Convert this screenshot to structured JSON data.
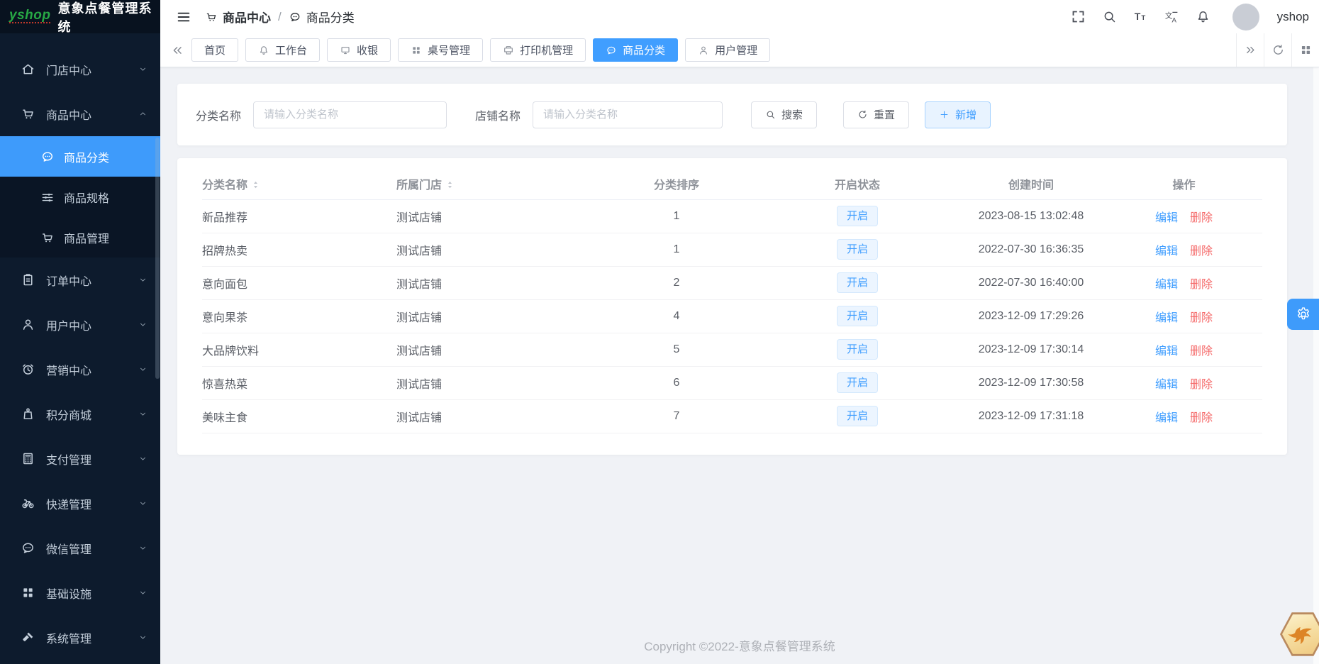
{
  "app": {
    "logo_text": "yshop",
    "title": "意象点餐管理系统"
  },
  "sidebar": {
    "items": [
      {
        "name": "store-center",
        "label": "门店中心",
        "icon": "home"
      },
      {
        "name": "goods-center",
        "label": "商品中心",
        "icon": "cart",
        "expanded": true,
        "children": [
          {
            "name": "goods-category",
            "label": "商品分类",
            "icon": "chat",
            "active": true
          },
          {
            "name": "goods-spec",
            "label": "商品规格",
            "icon": "sliders"
          },
          {
            "name": "goods-manage",
            "label": "商品管理",
            "icon": "cart"
          }
        ]
      },
      {
        "name": "order-center",
        "label": "订单中心",
        "icon": "clipboard"
      },
      {
        "name": "user-center",
        "label": "用户中心",
        "icon": "user"
      },
      {
        "name": "marketing-center",
        "label": "营销中心",
        "icon": "alarm"
      },
      {
        "name": "points-mall",
        "label": "积分商城",
        "icon": "bag"
      },
      {
        "name": "payment-manage",
        "label": "支付管理",
        "icon": "calculator"
      },
      {
        "name": "express-manage",
        "label": "快递管理",
        "icon": "bicycle"
      },
      {
        "name": "wechat-manage",
        "label": "微信管理",
        "icon": "chat"
      },
      {
        "name": "infrastructure",
        "label": "基础设施",
        "icon": "grid"
      },
      {
        "name": "system-manage",
        "label": "系统管理",
        "icon": "hammer"
      }
    ]
  },
  "header": {
    "breadcrumb": [
      {
        "label": "商品中心",
        "icon": "cart"
      },
      {
        "label": "商品分类",
        "icon": "chat"
      }
    ],
    "separator": "/",
    "username": "yshop"
  },
  "tabs": {
    "items": [
      {
        "name": "home",
        "label": "首页"
      },
      {
        "name": "workbench",
        "label": "工作台",
        "icon": "bell"
      },
      {
        "name": "cashier",
        "label": "收银",
        "icon": "monitor"
      },
      {
        "name": "table-management",
        "label": "桌号管理",
        "icon": "grid"
      },
      {
        "name": "printer-management",
        "label": "打印机管理",
        "icon": "printer"
      },
      {
        "name": "goods-category",
        "label": "商品分类",
        "icon": "chat",
        "active": true
      },
      {
        "name": "user-management",
        "label": "用户管理",
        "icon": "user"
      }
    ]
  },
  "filters": {
    "category_label": "分类名称",
    "category_placeholder": "请输入分类名称",
    "store_label": "店铺名称",
    "store_placeholder": "请输入分类名称",
    "search_label": "搜索",
    "reset_label": "重置",
    "add_label": "新增"
  },
  "table": {
    "columns": [
      {
        "label": "分类名称",
        "sortable": true
      },
      {
        "label": "所属门店",
        "sortable": true
      },
      {
        "label": "分类排序"
      },
      {
        "label": "开启状态"
      },
      {
        "label": "创建时间"
      },
      {
        "label": "操作"
      }
    ],
    "action_labels": {
      "edit": "编辑",
      "delete": "删除"
    },
    "rows": [
      {
        "name": "新品推荐",
        "store": "测试店铺",
        "sort": "1",
        "status": "开启",
        "created": "2023-08-15 13:02:48"
      },
      {
        "name": "招牌热卖",
        "store": "测试店铺",
        "sort": "1",
        "status": "开启",
        "created": "2022-07-30 16:36:35"
      },
      {
        "name": "意向面包",
        "store": "测试店铺",
        "sort": "2",
        "status": "开启",
        "created": "2022-07-30 16:40:00"
      },
      {
        "name": "意向果茶",
        "store": "测试店铺",
        "sort": "4",
        "status": "开启",
        "created": "2023-12-09 17:29:26"
      },
      {
        "name": "大品牌饮料",
        "store": "测试店铺",
        "sort": "5",
        "status": "开启",
        "created": "2023-12-09 17:30:14"
      },
      {
        "name": "惊喜热菜",
        "store": "测试店铺",
        "sort": "6",
        "status": "开启",
        "created": "2023-12-09 17:30:58"
      },
      {
        "name": "美味主食",
        "store": "测试店铺",
        "sort": "7",
        "status": "开启",
        "created": "2023-12-09 17:31:18"
      }
    ]
  },
  "footer": {
    "copyright": "Copyright ©2022-意象点餐管理系统"
  },
  "colors": {
    "primary": "#409eff",
    "danger": "#f56c6c",
    "sidebar_bg": "#0d1b2d",
    "submenu_bg": "#0a1525",
    "content_bg": "#f0f2f6",
    "badge_bg": "#ecf5ff",
    "badge_text": "#409eff"
  }
}
